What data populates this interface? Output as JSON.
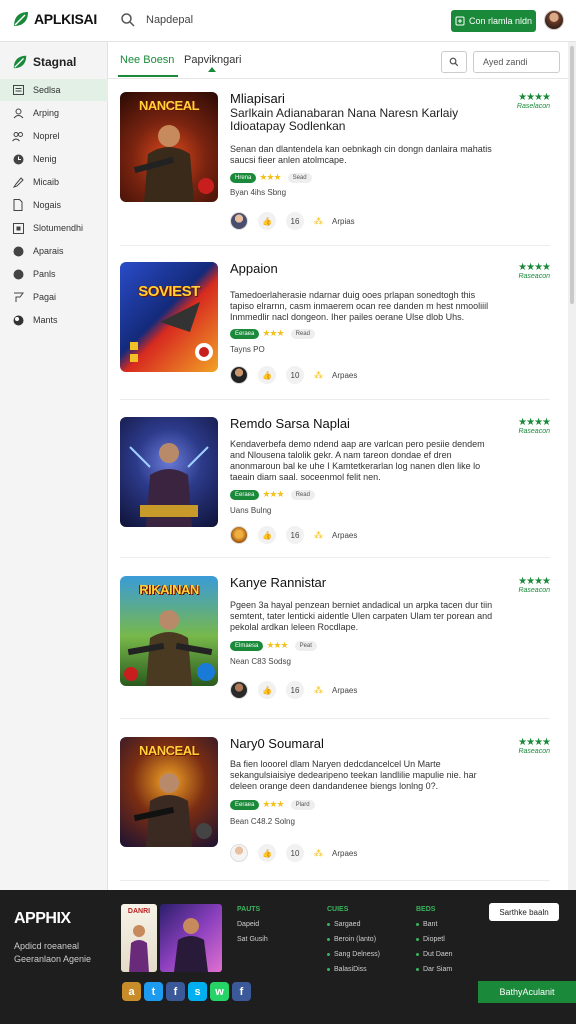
{
  "header": {
    "logo_text": "APLKISAI",
    "search_text": "Napdepal",
    "cta_label": "Con rlamla nldn"
  },
  "sidebar": {
    "title": "Stagnal",
    "items": [
      {
        "label": "Sedlsa",
        "icon": "grid-icon"
      },
      {
        "label": "Arping",
        "icon": "user-icon"
      },
      {
        "label": "Noprel",
        "icon": "group-icon"
      },
      {
        "label": "Nenig",
        "icon": "clock-icon"
      },
      {
        "label": "Micaib",
        "icon": "pen-icon"
      },
      {
        "label": "Nogais",
        "icon": "document-icon"
      },
      {
        "label": "Slotumendhi",
        "icon": "box-icon"
      },
      {
        "label": "Aparais",
        "icon": "dot-icon"
      },
      {
        "label": "Panls",
        "icon": "dot-icon"
      },
      {
        "label": "Pagai",
        "icon": "flag-icon"
      },
      {
        "label": "Mants",
        "icon": "globe-icon"
      }
    ]
  },
  "main": {
    "tabs": [
      "Nee Boesn",
      "Papvikngari"
    ],
    "filter_placeholder": "Ayed zandi"
  },
  "cards": [
    {
      "thumb_title": "NANCEAL",
      "title": "Mliapisari",
      "subtitle": "Sarlkain Adianabaran Nana Naresn Karlaiy Idioatapay Sodlenkan",
      "desc": "Senan dan dlantendela kan oebnkagh cin dongn danlaira mahatis saucsi fieer anlen atolmcape.",
      "pill": "Hrena",
      "pill_grey": "Sead",
      "info": "Byan   4ihs Sbng",
      "action_label": "Arpias",
      "action_count": "16",
      "rating_label": "Raselacon",
      "colors": [
        "#e0491b",
        "#5a1408"
      ]
    },
    {
      "thumb_title": "SOVIEST",
      "title": "Appaion",
      "subtitle": "",
      "desc": "Tamedoerlaherasie ndarnar duig ooes prlapan sonedtogh this tapiso elrarnn, casm inmaerem ocan ree danden m hest nmooliiil Inmmedlir nacl dongeon. Iher pailes oerane Ulse dlob Uhs.",
      "pill": "Eeraea",
      "pill_grey": "Read",
      "info": "Tayns   PO",
      "action_label": "Arpaes",
      "action_count": "10",
      "rating_label": "Raseacon",
      "colors": [
        "#f2a326",
        "#2a4cc9"
      ]
    },
    {
      "thumb_title": "",
      "title": "Remdo Sarsa Naplai",
      "subtitle": "",
      "desc": "Kendaverbefa demo ndend aap are varlcan pero pesiie dendem and Nlousena talolik gekr. A nam tareon dondae ef dren anonmaroun bal ke uhe I Kamtetkerarlan log nanen dlen like lo taeain diam saal. soceenmol felit nen.",
      "pill": "Eeraea",
      "pill_grey": "Read",
      "info": "Uans   Bulng",
      "action_label": "Arpaes",
      "action_count": "16",
      "rating_label": "Raseacon",
      "colors": [
        "#2c3a8a",
        "#0f1236"
      ]
    },
    {
      "thumb_title": "RIKAINAN",
      "title": "Kanye Rannistar",
      "subtitle": "",
      "desc": "Pgeen 3a hayal penzean berniet andadical un arpka tacen dur tiin semtent, tater lenticki aidentle Ulen carpaten Ulam ter porean and pekolal ardkan leleen Rocdlape.",
      "pill": "Elmaesa",
      "pill_grey": "Peat",
      "info": "Nean   C83 Sodsg",
      "action_label": "Arpaes",
      "action_count": "16",
      "rating_label": "Raseacon",
      "colors": [
        "#47a33b",
        "#1c4a2b"
      ]
    },
    {
      "thumb_title": "NANCEAL",
      "title": "Nary0 Soumaral",
      "subtitle": "",
      "desc": "Ba fien looorel dlam Naryen dedcdancelcel Un Marte sekangulsiaisiye dedearipeno teekan landlilie mapulie nie. har deleen orange deen dandandenee biengs lonlng 0?.",
      "pill": "Eeraea",
      "pill_grey": "Plard",
      "info": "Bean   C48.2 Solng",
      "action_label": "Arpaes",
      "action_count": "10",
      "rating_label": "Raseacon",
      "colors": [
        "#1a1233",
        "#7a2d12"
      ]
    }
  ],
  "footer": {
    "brand": "APPHIX",
    "tagline": "Apdicd roeaneal Geeranlaon Agenie",
    "tile_label": "DANRI",
    "button_label": "Sarthke baaln",
    "cta_label": "BathyAculanit",
    "columns": [
      {
        "head": "PAUTS",
        "items": [
          "Dapeid",
          "Sat Gusih"
        ],
        "bullets": false
      },
      {
        "head": "CUIES",
        "items": [
          "Sargaed",
          "Beroin (lanto)",
          "Sang Delness)",
          "BalasiDiss"
        ],
        "bullets": true
      },
      {
        "head": "BEDS",
        "items": [
          "Bant",
          "Diopetl",
          "Dut Daen",
          "Dar Siam"
        ],
        "bullets": true
      }
    ],
    "social": [
      {
        "icon": "yellow-app-icon",
        "glyph": "a",
        "color": "#c98c2a"
      },
      {
        "icon": "twitter-icon",
        "glyph": "t",
        "color": "#1d9bf0"
      },
      {
        "icon": "facebook-icon",
        "glyph": "f",
        "color": "#3b5998"
      },
      {
        "icon": "skype-icon",
        "glyph": "s",
        "color": "#00aff0"
      },
      {
        "icon": "whatsapp-icon",
        "glyph": "w",
        "color": "#25d366"
      },
      {
        "icon": "facebook-icon",
        "glyph": "f",
        "color": "#3b5998"
      }
    ]
  }
}
